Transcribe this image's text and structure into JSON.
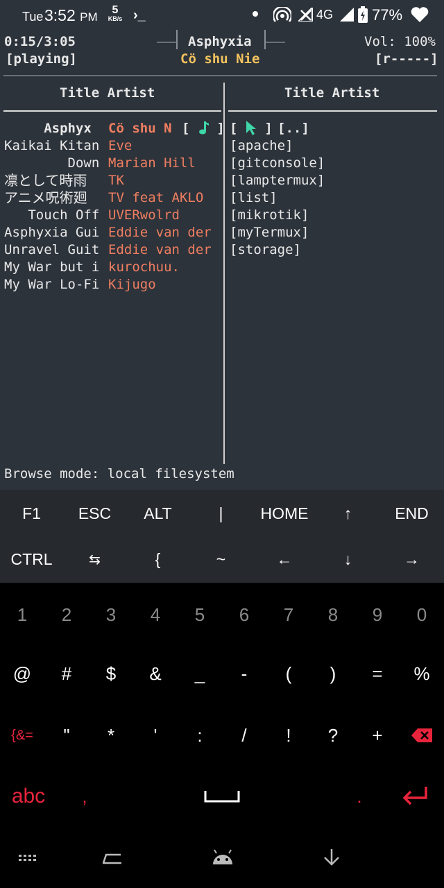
{
  "status_bar": {
    "day": "Tue",
    "time": "3:52",
    "ampm": "PM",
    "net_speed_value": "5",
    "net_speed_unit": "KB/s",
    "prompt_glyph": "›_",
    "network_type": "4G",
    "battery_percent": "77%",
    "icons": [
      "notification-dot-icon",
      "hotspot-icon",
      "no-signal-icon",
      "signal-icon",
      "battery-charging-icon",
      "heart-icon"
    ]
  },
  "player": {
    "position": "0:15/3:05",
    "state": "[playing]",
    "title": "Asphyxia",
    "artist": "Cö shu Nie",
    "volume": "Vol: 100%",
    "repeat": "[r-----]",
    "colors": {
      "artist_accent": "#f2c25e",
      "list_artist": "#ef7e60",
      "terminal_bg": "#2d333b"
    }
  },
  "playlist": {
    "header": "Title Artist",
    "rows": [
      {
        "title": "     Asphyx",
        "artist": "Cö shu N",
        "marker": "[ ♫ ]"
      },
      {
        "title": "Kaikai Kitan",
        "artist": "Eve"
      },
      {
        "title": "        Down",
        "artist": "Marian Hill"
      },
      {
        "title": "凛として時雨",
        "artist": "TK"
      },
      {
        "title": "アニメ呪術廻",
        "artist": "TV feat AKLO"
      },
      {
        "title": "   Touch Off",
        "artist": "UVERwolrd"
      },
      {
        "title": "Asphyxia Gui",
        "artist": "Eddie van der"
      },
      {
        "title": "Unravel Guit",
        "artist": "Eddie van der"
      },
      {
        "title": "My War but i",
        "artist": "kurochuu."
      },
      {
        "title": "My War Lo-Fi",
        "artist": "Kijugo"
      }
    ]
  },
  "browser": {
    "header": "Title Artist",
    "parent": "[..]",
    "entries": [
      "[apache]",
      "[gitconsole]",
      "[lamptermux]",
      "[list]",
      "[mikrotik]",
      "[myTermux]",
      "[storage]"
    ]
  },
  "footer": {
    "mode": "Browse mode: local filesystem"
  },
  "extra_keys": {
    "row1": [
      "F1",
      "ESC",
      "ALT",
      "|",
      "HOME",
      "↑",
      "END"
    ],
    "row2": [
      "CTRL",
      "⇆",
      "{",
      "~",
      "←",
      "↓",
      "→"
    ]
  },
  "keyboard": {
    "numbers": [
      "1",
      "2",
      "3",
      "4",
      "5",
      "6",
      "7",
      "8",
      "9",
      "0"
    ],
    "symbols1": [
      "@",
      "#",
      "$",
      "&",
      "_",
      "-",
      "(",
      ")",
      "=",
      "%"
    ],
    "symbols2_switch": "{&=",
    "symbols2": [
      "\"",
      "*",
      "'",
      ":",
      "/",
      "!",
      "?",
      "+"
    ],
    "abc": "abc",
    "comma": ",",
    "period": "."
  }
}
